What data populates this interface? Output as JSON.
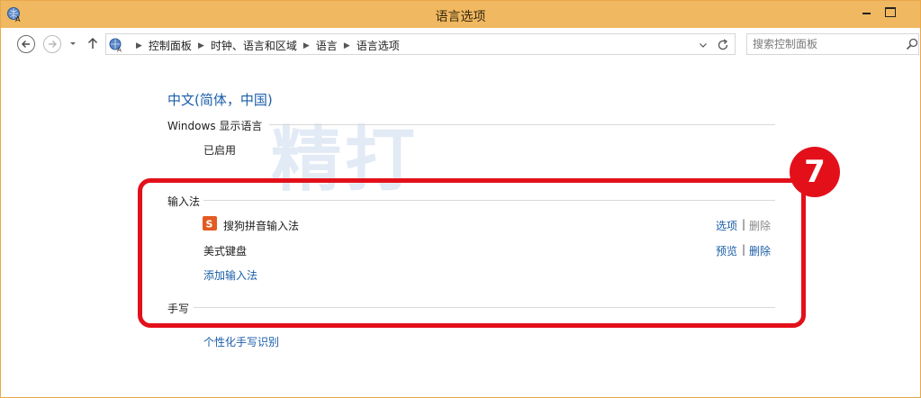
{
  "window": {
    "title": "语言选项"
  },
  "navigation": {
    "breadcrumbs": [
      "控制面板",
      "时钟、语言和区域",
      "语言",
      "语言选项"
    ],
    "search_placeholder": "搜索控制面板"
  },
  "main": {
    "language_title": "中文(简体，中国)",
    "display_language": {
      "heading": "Windows 显示语言",
      "status": "已启用"
    },
    "input_methods": {
      "heading": "输入法",
      "items": [
        {
          "name": "搜狗拼音输入法",
          "action1": "选项",
          "action1_enabled": true,
          "action2": "删除",
          "action2_enabled": false,
          "icon": "sogou-s-icon"
        },
        {
          "name": "美式键盘",
          "action1": "预览",
          "action1_enabled": true,
          "action2": "删除",
          "action2_enabled": true
        }
      ],
      "add_link": "添加输入法"
    },
    "handwriting": {
      "heading": "手写",
      "personalize_link": "个性化手写识别"
    }
  },
  "annotation": {
    "watermark": "精打",
    "step_number": "7",
    "highlight_color": "#e3101a"
  },
  "colors": {
    "titlebar": "#f0b860",
    "link": "#1a5ea8"
  }
}
